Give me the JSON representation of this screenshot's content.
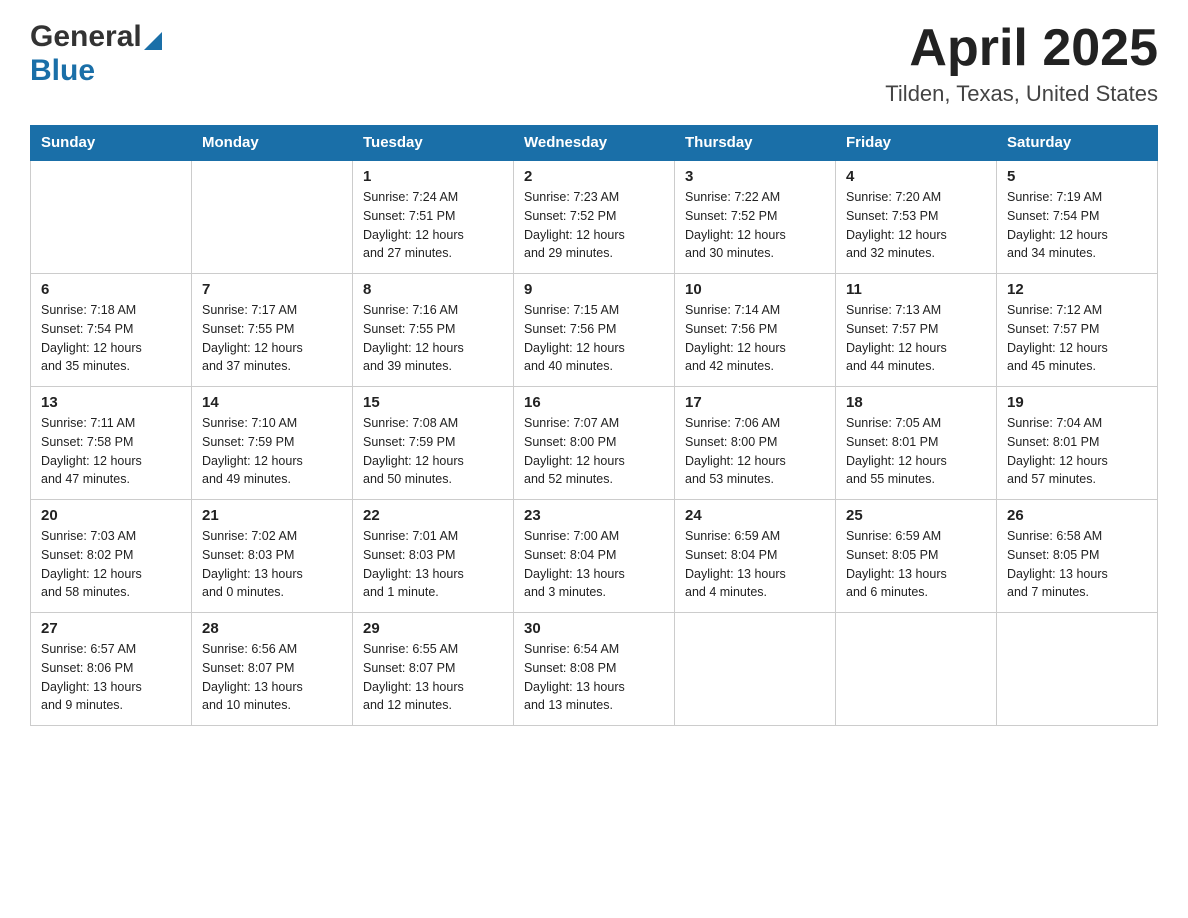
{
  "header": {
    "title": "April 2025",
    "location": "Tilden, Texas, United States",
    "logo_general": "General",
    "logo_blue": "Blue"
  },
  "days_of_week": [
    "Sunday",
    "Monday",
    "Tuesday",
    "Wednesday",
    "Thursday",
    "Friday",
    "Saturday"
  ],
  "weeks": [
    [
      {
        "day": "",
        "info": ""
      },
      {
        "day": "",
        "info": ""
      },
      {
        "day": "1",
        "info": "Sunrise: 7:24 AM\nSunset: 7:51 PM\nDaylight: 12 hours\nand 27 minutes."
      },
      {
        "day": "2",
        "info": "Sunrise: 7:23 AM\nSunset: 7:52 PM\nDaylight: 12 hours\nand 29 minutes."
      },
      {
        "day": "3",
        "info": "Sunrise: 7:22 AM\nSunset: 7:52 PM\nDaylight: 12 hours\nand 30 minutes."
      },
      {
        "day": "4",
        "info": "Sunrise: 7:20 AM\nSunset: 7:53 PM\nDaylight: 12 hours\nand 32 minutes."
      },
      {
        "day": "5",
        "info": "Sunrise: 7:19 AM\nSunset: 7:54 PM\nDaylight: 12 hours\nand 34 minutes."
      }
    ],
    [
      {
        "day": "6",
        "info": "Sunrise: 7:18 AM\nSunset: 7:54 PM\nDaylight: 12 hours\nand 35 minutes."
      },
      {
        "day": "7",
        "info": "Sunrise: 7:17 AM\nSunset: 7:55 PM\nDaylight: 12 hours\nand 37 minutes."
      },
      {
        "day": "8",
        "info": "Sunrise: 7:16 AM\nSunset: 7:55 PM\nDaylight: 12 hours\nand 39 minutes."
      },
      {
        "day": "9",
        "info": "Sunrise: 7:15 AM\nSunset: 7:56 PM\nDaylight: 12 hours\nand 40 minutes."
      },
      {
        "day": "10",
        "info": "Sunrise: 7:14 AM\nSunset: 7:56 PM\nDaylight: 12 hours\nand 42 minutes."
      },
      {
        "day": "11",
        "info": "Sunrise: 7:13 AM\nSunset: 7:57 PM\nDaylight: 12 hours\nand 44 minutes."
      },
      {
        "day": "12",
        "info": "Sunrise: 7:12 AM\nSunset: 7:57 PM\nDaylight: 12 hours\nand 45 minutes."
      }
    ],
    [
      {
        "day": "13",
        "info": "Sunrise: 7:11 AM\nSunset: 7:58 PM\nDaylight: 12 hours\nand 47 minutes."
      },
      {
        "day": "14",
        "info": "Sunrise: 7:10 AM\nSunset: 7:59 PM\nDaylight: 12 hours\nand 49 minutes."
      },
      {
        "day": "15",
        "info": "Sunrise: 7:08 AM\nSunset: 7:59 PM\nDaylight: 12 hours\nand 50 minutes."
      },
      {
        "day": "16",
        "info": "Sunrise: 7:07 AM\nSunset: 8:00 PM\nDaylight: 12 hours\nand 52 minutes."
      },
      {
        "day": "17",
        "info": "Sunrise: 7:06 AM\nSunset: 8:00 PM\nDaylight: 12 hours\nand 53 minutes."
      },
      {
        "day": "18",
        "info": "Sunrise: 7:05 AM\nSunset: 8:01 PM\nDaylight: 12 hours\nand 55 minutes."
      },
      {
        "day": "19",
        "info": "Sunrise: 7:04 AM\nSunset: 8:01 PM\nDaylight: 12 hours\nand 57 minutes."
      }
    ],
    [
      {
        "day": "20",
        "info": "Sunrise: 7:03 AM\nSunset: 8:02 PM\nDaylight: 12 hours\nand 58 minutes."
      },
      {
        "day": "21",
        "info": "Sunrise: 7:02 AM\nSunset: 8:03 PM\nDaylight: 13 hours\nand 0 minutes."
      },
      {
        "day": "22",
        "info": "Sunrise: 7:01 AM\nSunset: 8:03 PM\nDaylight: 13 hours\nand 1 minute."
      },
      {
        "day": "23",
        "info": "Sunrise: 7:00 AM\nSunset: 8:04 PM\nDaylight: 13 hours\nand 3 minutes."
      },
      {
        "day": "24",
        "info": "Sunrise: 6:59 AM\nSunset: 8:04 PM\nDaylight: 13 hours\nand 4 minutes."
      },
      {
        "day": "25",
        "info": "Sunrise: 6:59 AM\nSunset: 8:05 PM\nDaylight: 13 hours\nand 6 minutes."
      },
      {
        "day": "26",
        "info": "Sunrise: 6:58 AM\nSunset: 8:05 PM\nDaylight: 13 hours\nand 7 minutes."
      }
    ],
    [
      {
        "day": "27",
        "info": "Sunrise: 6:57 AM\nSunset: 8:06 PM\nDaylight: 13 hours\nand 9 minutes."
      },
      {
        "day": "28",
        "info": "Sunrise: 6:56 AM\nSunset: 8:07 PM\nDaylight: 13 hours\nand 10 minutes."
      },
      {
        "day": "29",
        "info": "Sunrise: 6:55 AM\nSunset: 8:07 PM\nDaylight: 13 hours\nand 12 minutes."
      },
      {
        "day": "30",
        "info": "Sunrise: 6:54 AM\nSunset: 8:08 PM\nDaylight: 13 hours\nand 13 minutes."
      },
      {
        "day": "",
        "info": ""
      },
      {
        "day": "",
        "info": ""
      },
      {
        "day": "",
        "info": ""
      }
    ]
  ]
}
